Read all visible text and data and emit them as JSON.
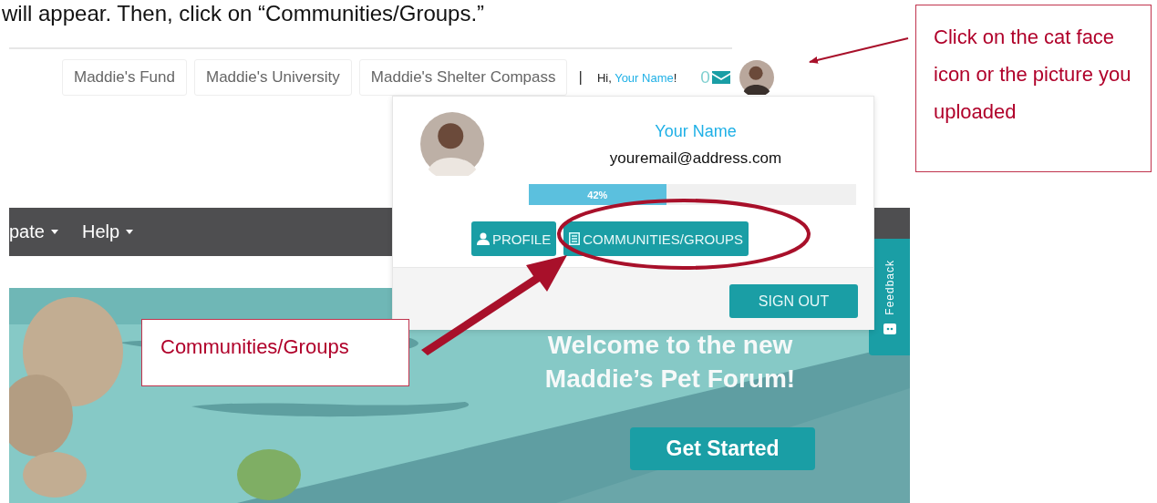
{
  "instruction": "will appear. Then, click on “Communities/Groups.”",
  "top_links": [
    "Maddie's Fund",
    "Maddie's University",
    "Maddie's Shelter Compass"
  ],
  "user_bar": {
    "separator": "|",
    "greeting_prefix": "Hi, ",
    "name": "Your Name",
    "greeting_suffix": "!",
    "message_count": "0"
  },
  "user_menu": {
    "name": "Your Name",
    "email": "youremail@address.com",
    "progress": {
      "level": 0.42,
      "label": "42%"
    },
    "buttons": [
      {
        "label": "PROFILE",
        "kind": "profile"
      },
      {
        "label": "COMMUNITIES/GROUPS",
        "kind": "communities"
      }
    ],
    "sign_out": "SIGN OUT"
  },
  "nav": [
    "pate",
    "Help"
  ],
  "hero": {
    "heading_lines": [
      "Welcome to the new",
      "Maddie’s Pet Forum!"
    ],
    "button": "Get Started"
  },
  "feedback_tab": "Feedback",
  "callouts": [
    {
      "text": "Click on the cat face icon or the picture you uploaded",
      "kind": "avatar"
    },
    {
      "text": "Communities/Groups",
      "kind": "communities"
    }
  ]
}
